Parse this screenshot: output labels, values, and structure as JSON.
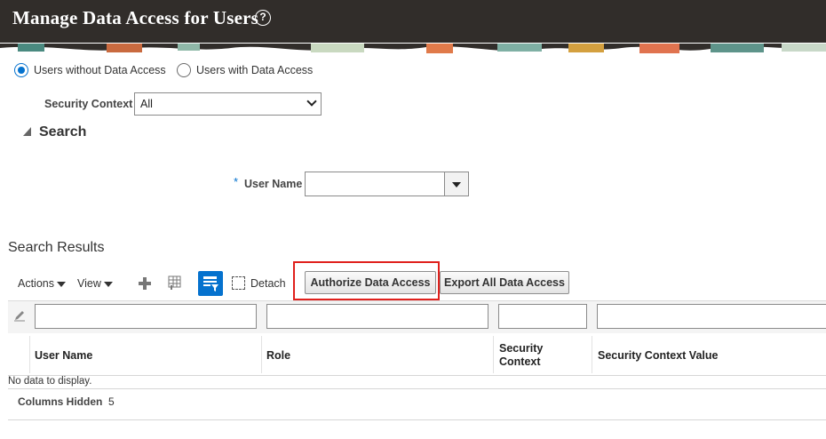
{
  "header": {
    "title": "Manage Data Access for Users",
    "help_icon": "?"
  },
  "mode": {
    "options": [
      "Users without Data Access",
      "Users with Data Access"
    ],
    "selected": "Users without Data Access"
  },
  "security_context": {
    "label": "Security Context",
    "value": "All"
  },
  "search": {
    "title": "Search",
    "required_marker": "*",
    "user_name_label": "User Name",
    "user_name_value": ""
  },
  "results": {
    "title": "Search Results",
    "toolbar": {
      "actions_label": "Actions",
      "view_label": "View",
      "detach_label": "Detach",
      "authorize_label": "Authorize Data Access",
      "export_label": "Export All Data Access"
    },
    "columns": [
      "User Name",
      "Role",
      "Security Context",
      "Security Context Value"
    ],
    "columns_line1": [
      "Security"
    ],
    "columns_line2": [
      "Context"
    ],
    "empty_text": "No data to display.",
    "columns_hidden_label": "Columns Hidden",
    "columns_hidden_count": "5"
  },
  "colors": {
    "header_bg": "#312d2a",
    "accent": "#0572ce",
    "highlight": "#e0201c"
  }
}
